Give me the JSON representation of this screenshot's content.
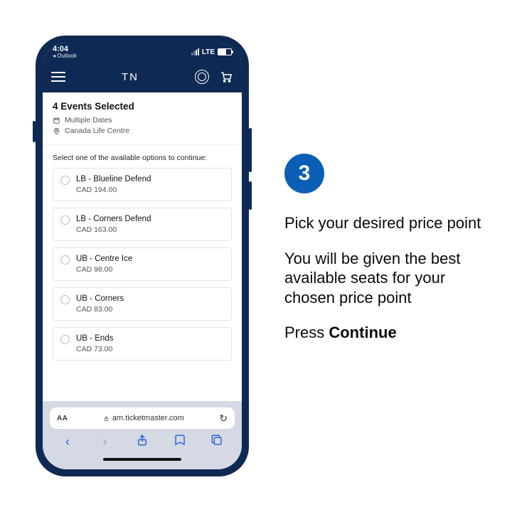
{
  "status": {
    "time": "4:04",
    "back_app": "Outlook",
    "network": "LTE"
  },
  "appbar": {
    "logo": "TN"
  },
  "header": {
    "title": "4 Events Selected",
    "dates": "Multiple Dates",
    "venue": "Canada Life Centre"
  },
  "instruction": "Select one of the available options to continue:",
  "options": [
    {
      "name": "LB - Blueline Defend",
      "price": "CAD 194.00"
    },
    {
      "name": "LB - Corners Defend",
      "price": "CAD 163.00"
    },
    {
      "name": "UB - Centre Ice",
      "price": "CAD 98.00"
    },
    {
      "name": "UB - Corners",
      "price": "CAD 83.00"
    },
    {
      "name": "UB - Ends",
      "price": "CAD 73.00"
    }
  ],
  "browser": {
    "aa": "AA",
    "lock": "",
    "domain": "am.ticketmaster.com",
    "reload": "↻"
  },
  "caption": {
    "step": "3",
    "line1": "Pick your desired price point",
    "line2": "You will be given the best available seats for your chosen price point",
    "line3_pre": "Press ",
    "line3_bold": "Continue"
  }
}
